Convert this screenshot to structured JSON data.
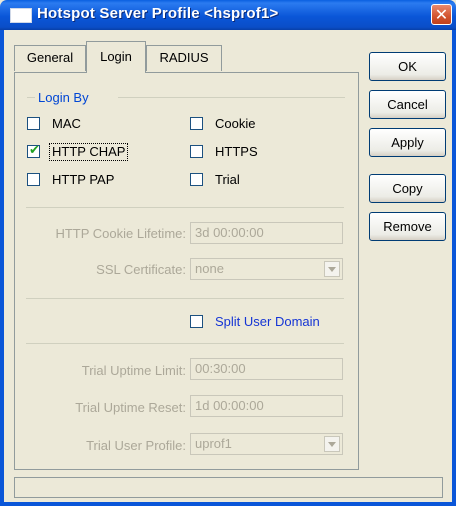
{
  "window": {
    "title": "Hotspot Server Profile <hsprof1>",
    "close_glyph": "✕"
  },
  "tabs": [
    {
      "label": "General"
    },
    {
      "label": "Login"
    },
    {
      "label": "RADIUS"
    }
  ],
  "login_by": {
    "label": "Login By",
    "options": {
      "mac": {
        "label": "MAC",
        "checked": false
      },
      "http_chap": {
        "label": "HTTP CHAP",
        "checked": true
      },
      "http_pap": {
        "label": "HTTP PAP",
        "checked": false
      },
      "cookie": {
        "label": "Cookie",
        "checked": false
      },
      "https": {
        "label": "HTTPS",
        "checked": false
      },
      "trial": {
        "label": "Trial",
        "checked": false
      }
    }
  },
  "fields": {
    "cookie_lifetime": {
      "label": "HTTP Cookie Lifetime:",
      "value": "3d 00:00:00"
    },
    "ssl_cert": {
      "label": "SSL Certificate:",
      "value": "none"
    },
    "split_user_domain": {
      "label": "Split User Domain",
      "checked": false
    },
    "trial_uptime_limit": {
      "label": "Trial Uptime Limit:",
      "value": "00:30:00"
    },
    "trial_uptime_reset": {
      "label": "Trial Uptime Reset:",
      "value": "1d 00:00:00"
    },
    "trial_user_profile": {
      "label": "Trial User Profile:",
      "value": "uprof1"
    }
  },
  "buttons": {
    "ok": "OK",
    "cancel": "Cancel",
    "apply": "Apply",
    "copy": "Copy",
    "remove": "Remove"
  },
  "check_glyph": "✔"
}
